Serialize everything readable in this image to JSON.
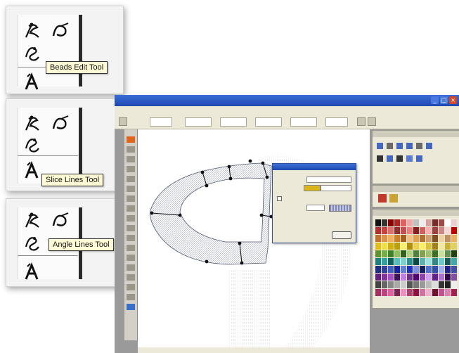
{
  "callouts": [
    {
      "tooltip": "Beads Edit Tool"
    },
    {
      "tooltip": "Slice Lines Tool"
    },
    {
      "tooltip": "Angle Lines Tool"
    }
  ],
  "icons": {
    "needle": "needle-icon",
    "stitch": "stitch-icon",
    "beads": "beads-icon",
    "lettering": "lettering-icon"
  },
  "colors": {
    "tooltip_bg": "#fffbd6",
    "title_bar": "#1d49b0",
    "toolbar_bg": "#ece9d8",
    "node": "#111111"
  }
}
